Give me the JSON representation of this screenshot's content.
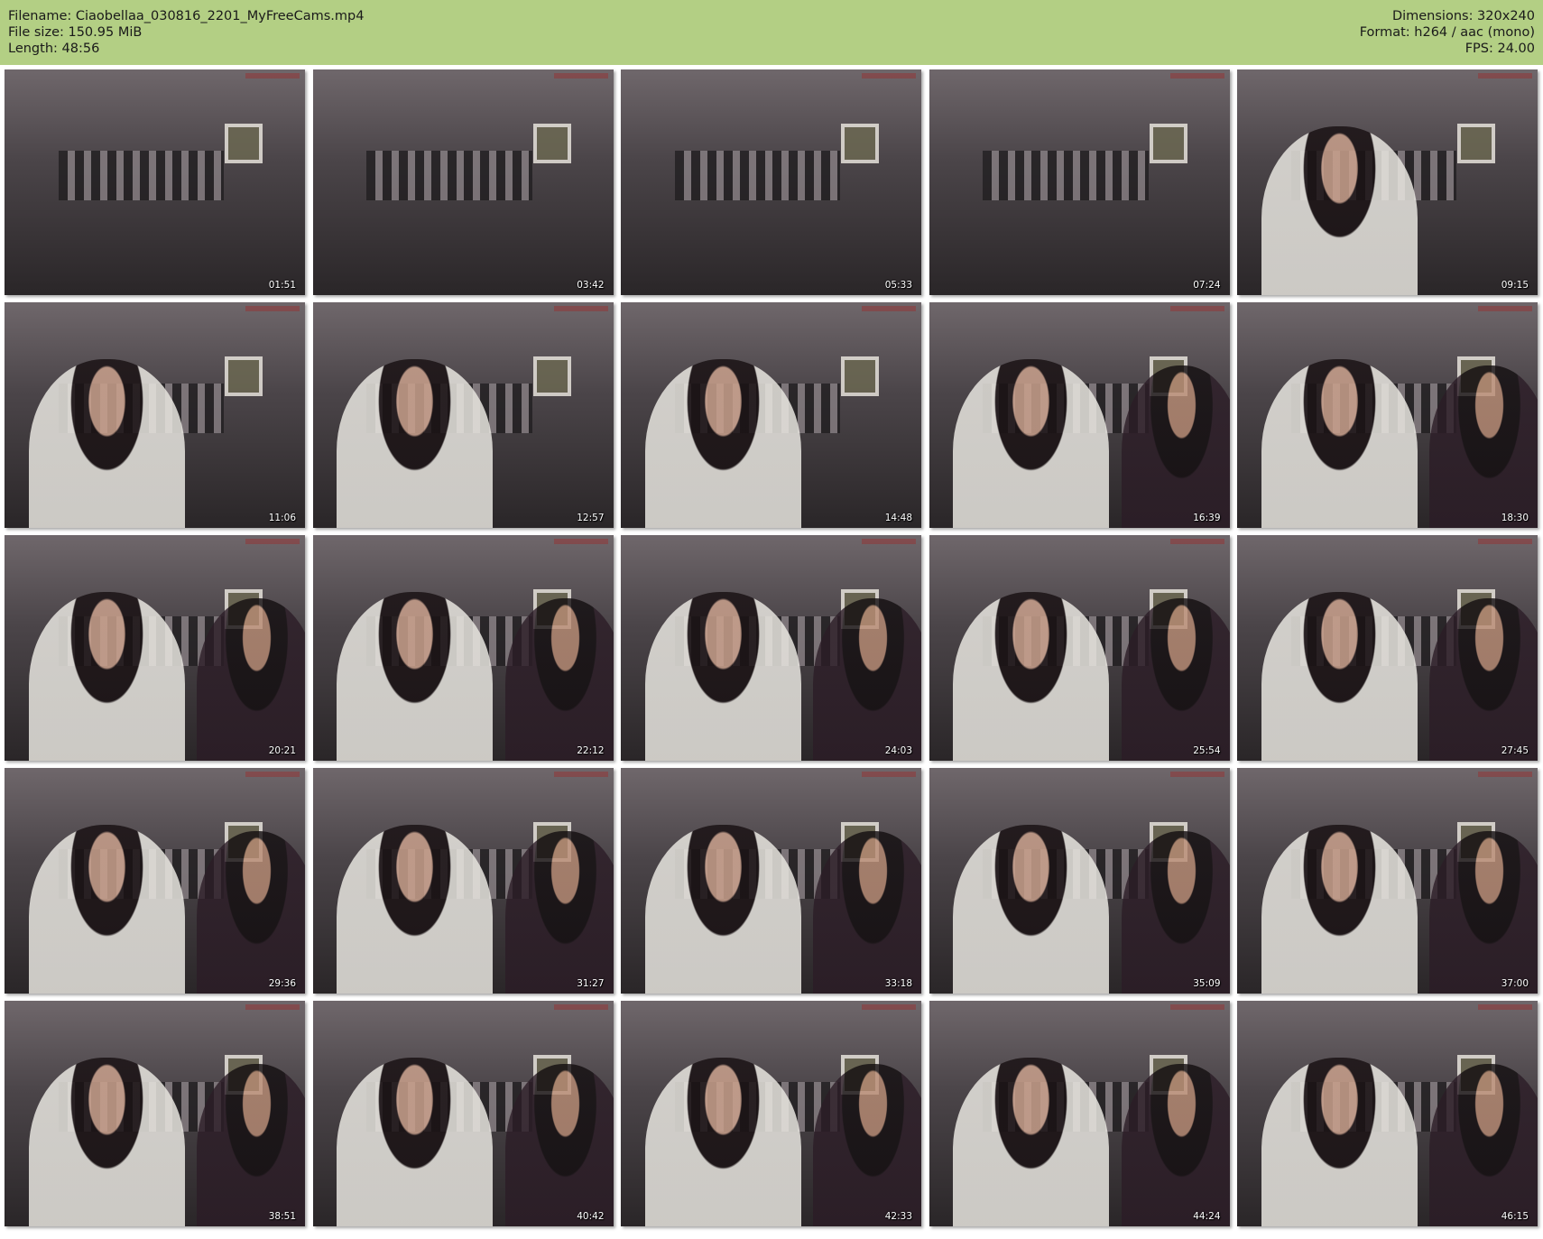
{
  "header": {
    "filename": "Filename: Ciaobellaa_030816_2201_MyFreeCams.mp4",
    "filesize": "File size: 150.95 MiB",
    "length": "Length: 48:56",
    "dimensions": "Dimensions: 320x240",
    "format": "Format: h264 / aac (mono)",
    "fps": "FPS: 24.00"
  },
  "colors": {
    "header_bg": "#b3cf84",
    "page_bg": "#ffffff"
  },
  "thumbnails": [
    "01:51",
    "03:42",
    "05:33",
    "07:24",
    "09:15",
    "11:06",
    "12:57",
    "14:48",
    "16:39",
    "18:30",
    "20:21",
    "22:12",
    "24:03",
    "25:54",
    "27:45",
    "29:36",
    "31:27",
    "33:18",
    "35:09",
    "37:00",
    "38:51",
    "40:42",
    "42:33",
    "44:24",
    "46:15"
  ]
}
